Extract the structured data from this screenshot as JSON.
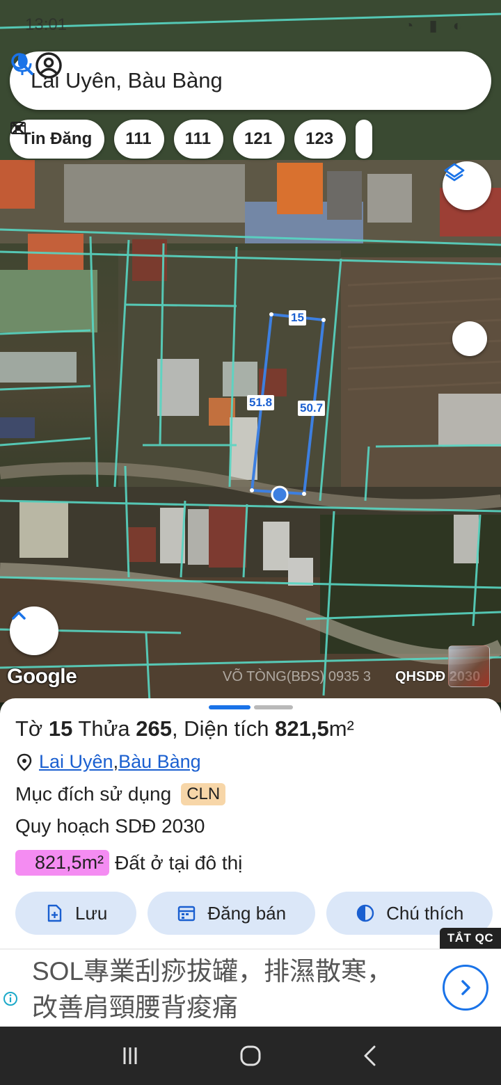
{
  "status_bar": {
    "time": "13:01"
  },
  "search": {
    "query": "Lai Uyên, Bàu Bàng"
  },
  "chips": [
    {
      "label": "Tin Đăng",
      "icon": "listing-icon"
    },
    {
      "label": "111",
      "icon": "tool-icon"
    },
    {
      "label": "111",
      "icon": "tool-icon"
    },
    {
      "label": "121",
      "icon": "tool-icon"
    },
    {
      "label": "123",
      "icon": "tool-icon"
    }
  ],
  "map": {
    "measurements": {
      "top": "15",
      "left": "51.8",
      "right": "50.7"
    },
    "google_logo": "Google",
    "watermark": "VÕ TÒNG(BĐS) 0935 3",
    "overlay_label": "QHSDĐ 2030"
  },
  "parcel": {
    "prefix_to": "Tờ ",
    "sheet_no": "15",
    "mid_thua": " Thửa ",
    "parcel_no": "265",
    "mid_area": ", Diện tích ",
    "area": "821,5",
    "unit": "m²",
    "commune": "Lai Uyên",
    "district": "Bàu Bàng",
    "purpose_label": "Mục đích sử dụng",
    "purpose_code": "CLN",
    "plan_label": "Quy hoạch SDĐ 2030",
    "plan_area": "821,5m²",
    "plan_desc": "Đất ở tại đô thị"
  },
  "actions": [
    {
      "label": "Lưu",
      "icon": "save-icon"
    },
    {
      "label": "Đăng bán",
      "icon": "calendar-icon"
    },
    {
      "label": "Chú thích",
      "icon": "contrast-icon"
    }
  ],
  "ad": {
    "off_label": "TẮT QC",
    "text": "SOL專業刮痧拔罐，排濕散寒，改善肩頸腰背痠痛"
  },
  "colors": {
    "parcel_outline": "#3d7fe0",
    "cadastral_lines": "#58d6c3",
    "accent": "#1a73e8",
    "cln_badge": "#f7d6a8",
    "plan_badge": "#f48cf2"
  }
}
